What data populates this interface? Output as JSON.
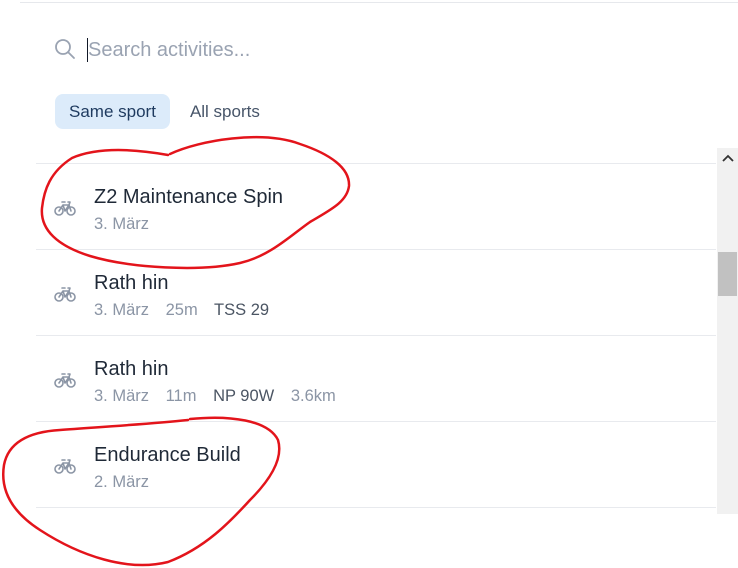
{
  "search": {
    "placeholder": "Search activities...",
    "value": ""
  },
  "filters": {
    "same_sport": "Same sport",
    "all_sports": "All sports",
    "selected": "Same sport"
  },
  "activities": [
    {
      "icon": "bicycle-icon",
      "title": "Z2 Maintenance Spin",
      "date": "3. März",
      "duration": "",
      "tss": "",
      "np": "",
      "distance": ""
    },
    {
      "icon": "bicycle-icon",
      "title": "Rath hin",
      "date": "3. März",
      "duration": "25m",
      "tss": "TSS 29",
      "np": "",
      "distance": ""
    },
    {
      "icon": "bicycle-icon",
      "title": "Rath hin",
      "date": "3. März",
      "duration": "11m",
      "tss": "",
      "np": "NP 90W",
      "distance": "3.6km"
    },
    {
      "icon": "bicycle-icon",
      "title": "Endurance Build",
      "date": "2. März",
      "duration": "",
      "tss": "",
      "np": "",
      "distance": ""
    }
  ],
  "colors": {
    "active_chip_bg": "#dcebfa",
    "annotation": "#e3141b",
    "muted_text": "#8b95a5",
    "title_text": "#1f2937"
  }
}
